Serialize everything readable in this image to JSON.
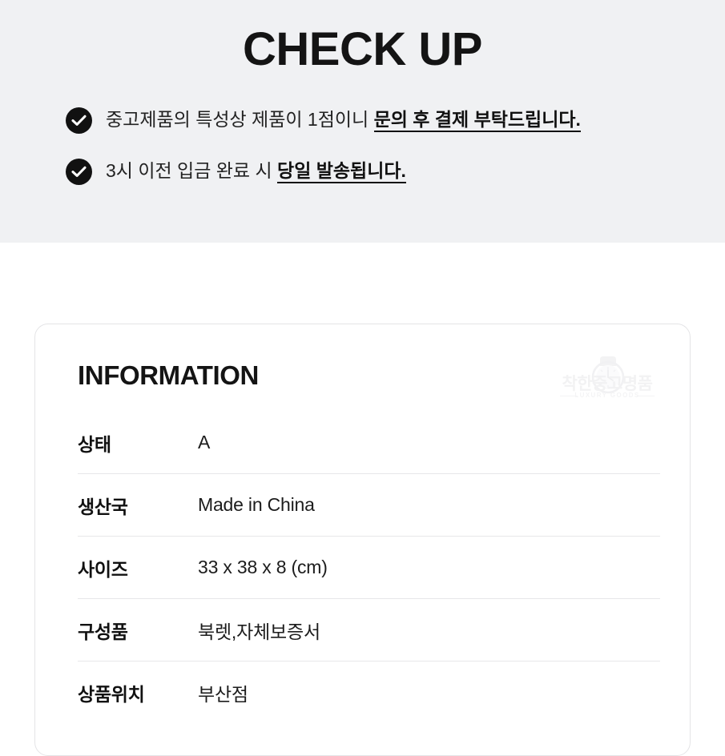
{
  "checkup": {
    "title": "CHECK UP",
    "items": [
      {
        "icon": "check-circle-icon",
        "text_plain": "중고제품의 특성상 제품이 1점이니 ",
        "text_emphasis": "문의 후 결제 부탁드립니다."
      },
      {
        "icon": "check-circle-icon",
        "text_plain": "3시 이전 입금 완료 시 ",
        "text_emphasis": "당일 발송됩니다."
      }
    ]
  },
  "information": {
    "title": "INFORMATION",
    "watermark": {
      "icon": "wristwatch-icon",
      "korean": "착한중고명품",
      "english": "LUXURY GOODS"
    },
    "rows": [
      {
        "label": "상태",
        "value": "A"
      },
      {
        "label": "생산국",
        "value": "Made in China"
      },
      {
        "label": "사이즈",
        "value": "33 x 38 x 8 (cm)"
      },
      {
        "label": "구성품",
        "value": "북렛,자체보증서"
      },
      {
        "label": "상품위치",
        "value": "부산점"
      }
    ]
  },
  "colors": {
    "band_background": "#f0f1f3",
    "page_background": "#ffffff",
    "text_primary": "#141414",
    "badge": "#111111",
    "divider": "#e7e7e9",
    "card_border": "#e4e4e6",
    "watermark": "#f2f2f3"
  }
}
